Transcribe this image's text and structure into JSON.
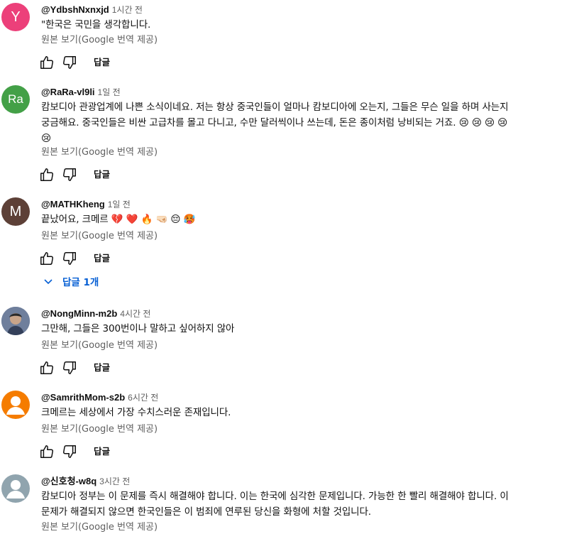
{
  "translate_label": "원본 보기(Google 번역 제공)",
  "reply_label": "답글",
  "comments": [
    {
      "author": "@YdbshNxnxjd",
      "time": "1시간 전",
      "avatar_text": "Y",
      "avatar_color": "#ec407a",
      "text": "\"한국은 국민을 생각합니다."
    },
    {
      "author": "@RaRa-vl9li",
      "time": "1일 전",
      "avatar_text": "Ra",
      "avatar_color": "#43a047",
      "text": "캄보디아 관광업계에 나쁜 소식이네요. 저는 항상 중국인들이 얼마나 캄보디아에 오는지, 그들은 무슨 일을 하며 사는지\n궁금해요. 중국인들은 비싼 고급차를 몰고 다니고, 수만 달러씩이나 쓰는데, 돈은 종이처럼 낭비되는 거죠. 😢 😢 😢 😢\n😢"
    },
    {
      "author": "@MATHKheng",
      "time": "1일 전",
      "avatar_text": "M",
      "avatar_color": "#5d4037",
      "text": "끝났어요, 크메르 💔 ❤️ 🔥 🤜🏻 😔 🥵",
      "replies_label": "답글 1개"
    },
    {
      "author": "@NongMinn-m2b",
      "time": "4시간 전",
      "avatar_text": "",
      "avatar_color": "#5b6f8f",
      "text": "그만해, 그들은 300번이나 말하고 싶어하지 않아"
    },
    {
      "author": "@SamrithMom-s2b",
      "time": "6시간 전",
      "avatar_text": "",
      "avatar_color": "#f57c00",
      "text": "크메르는 세상에서 가장 수치스러운 존재입니다."
    },
    {
      "author": "@신호청-w8q",
      "time": "3시간 전",
      "avatar_text": "",
      "avatar_color": "#90a4ae",
      "text": "캄보디아 정부는 이 문제를 즉시 해결해야 합니다. 이는 한국에 심각한 문제입니다. 가능한 한 빨리 해결해야 합니다. 이\n문제가 해결되지 않으면 한국인들은 이 범죄에 연루된 당신을 화형에 처할 것입니다."
    }
  ]
}
